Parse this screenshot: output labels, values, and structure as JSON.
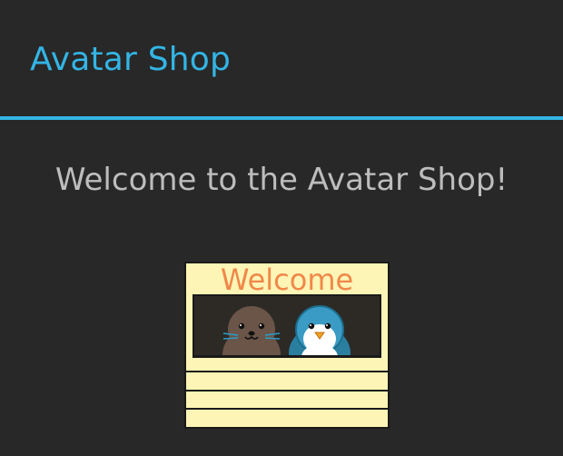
{
  "dialog": {
    "title": "Avatar Shop",
    "message": "Welcome to the Avatar Shop!",
    "image": {
      "sign_text": "Welcome",
      "icon": "avatar-shop-booth-illustration"
    }
  },
  "colors": {
    "background": "#282828",
    "accent": "#33b5e5",
    "message_text": "#bdbdbd",
    "booth_fill": "#fdf5b5",
    "sign_text": "#f0884a"
  }
}
